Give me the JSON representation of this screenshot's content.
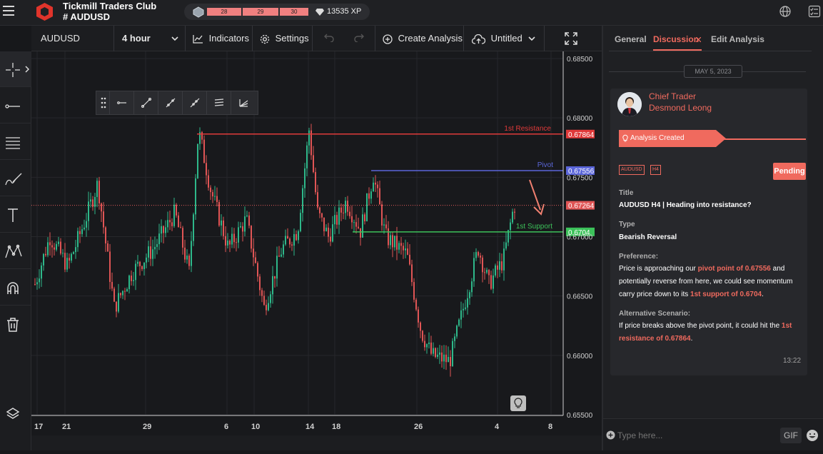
{
  "app": {
    "club_title": "Tickmill Traders Club",
    "channel": "# AUDUSD",
    "xp_segments": [
      "28",
      "29",
      "30"
    ],
    "xp_value": "13535 XP",
    "colors": {
      "accent": "#f06a5e",
      "bg": "#18191c"
    }
  },
  "toolbar": {
    "symbol": "AUDUSD",
    "interval": "4 hour",
    "indicators_label": "Indicators",
    "settings_label": "Settings",
    "create_analysis_label": "Create Analysis",
    "layout_name": "Untitled"
  },
  "chart": {
    "price_ticks": [
      "0.68500",
      "0.68000",
      "0.67500",
      "0.67000",
      "0.66500",
      "0.66000",
      "0.65500"
    ],
    "date_ticks": [
      "17",
      "21",
      "29",
      "6",
      "10",
      "14",
      "18",
      "26",
      "4",
      "8"
    ],
    "resistance": {
      "label": "1st Resistance",
      "price": "0.67864"
    },
    "pivot": {
      "label": "Pivot",
      "price": "0.67556"
    },
    "support": {
      "label": "1st Support",
      "price": "0.6704"
    },
    "current_price": "0.67264"
  },
  "panel": {
    "tabs": [
      "General",
      "Discussion",
      "Edit Analysis"
    ],
    "date": "MAY 5, 2023",
    "author_role": "Chief Trader",
    "author_name": "Desmond Leong",
    "banner": "Analysis Created",
    "tags": [
      "AUDUSD",
      "H4"
    ],
    "status": "Pending",
    "title_label": "Title",
    "title_value": "AUDUSD H4 | Heading into resistance?",
    "type_label": "Type",
    "type_value": "Bearish Reversal",
    "preference_label": "Preference:",
    "preference_1": "Price is approaching our ",
    "preference_hl1": "pivot point of 0.67556",
    "preference_2": " and potentially reverse from here, we could see momentum carry price down to its ",
    "preference_hl2": "1st support of 0.6704",
    "preference_3": ".",
    "alt_label": "Alternative Scenario:",
    "alt_1": "If price breaks above the pivot point, it could hit the ",
    "alt_hl": "1st resistance of 0.67864",
    "alt_2": ".",
    "time": "13:22",
    "input_placeholder": "Type here...",
    "gif_label": "GIF"
  }
}
